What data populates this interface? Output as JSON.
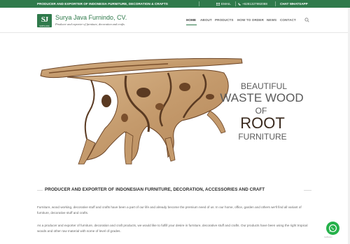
{
  "topbar": {
    "tagline": "PRODUCER AND EXPORTER OF INDONESIA FURNITURE, DECORATION & CRAFTS",
    "email_label": "EMAIL",
    "phone": "+6281327992088",
    "whatsapp_label": "CHAT WHATSAPP"
  },
  "header": {
    "logo_text": "SJ",
    "logo_small": "SURYA JAVA",
    "brand": "Surya Java Furnindo, CV.",
    "brand_sub": "Producer and exporter of furniture, decoration and crafts",
    "nav": [
      {
        "label": "HOME",
        "active": true
      },
      {
        "label": "ABOUT"
      },
      {
        "label": "PRODUCTS"
      },
      {
        "label": "HOW TO ORDER"
      },
      {
        "label": "NEWS"
      },
      {
        "label": "CONTACT"
      }
    ]
  },
  "hero": {
    "line1": "BEAUTIFUL",
    "line2": "WASTE WOOD",
    "line3": "OF",
    "line4": "ROOT",
    "line5": "FURNITURE"
  },
  "main": {
    "section_title": "PRODUCER AND EXPORTER OF INDONESIAN FURNITURE, DECORATION, ACCESSORIES AND CRAFT",
    "paragraph1": "Furniture, wood working, decorative stuff and crafts have been a part of our life and already become the premium need of us. In our home, office, garden and others we'll find all variant of furniture, decorative stuff and crafts.",
    "paragraph2": "As a producer and exporter of furniture, decoration and craft products, we would like to fulfill your desire in furniture, decorative stuff and crafts. Our products have been using the right tropical woods and other raw material with some of level of grades."
  },
  "widget": {
    "label": "GetButton"
  },
  "colors": {
    "brand_green": "#2f7a4b",
    "whatsapp_green": "#25b14a",
    "wood_light": "#c9a47a",
    "wood_dark": "#5a3a22"
  }
}
